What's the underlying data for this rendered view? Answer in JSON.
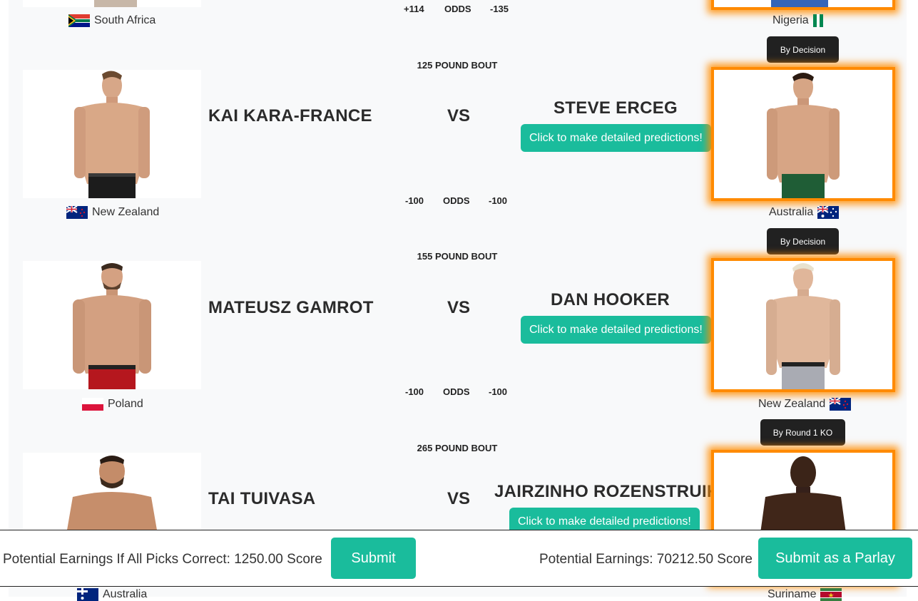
{
  "top_partial": {
    "left_country": "South Africa",
    "odds_left": "+114",
    "odds_label": "ODDS",
    "odds_right": "-135",
    "right_country": "Nigeria",
    "method": "By Decision"
  },
  "bouts": [
    {
      "weight": "125 POUND BOUT",
      "left_name": "KAI KARA-FRANCE",
      "left_country": "New Zealand",
      "vs": "VS",
      "right_name": "STEVE ERCEG",
      "right_country": "Australia",
      "predict_label": "Click to make detailed predictions!",
      "odds_left": "-100",
      "odds_label": "ODDS",
      "odds_right": "-100",
      "method": "By Decision"
    },
    {
      "weight": "155 POUND BOUT",
      "left_name": "MATEUSZ GAMROT",
      "left_country": "Poland",
      "vs": "VS",
      "right_name": "DAN HOOKER",
      "right_country": "New Zealand",
      "predict_label": "Click to make detailed predictions!",
      "odds_left": "-100",
      "odds_label": "ODDS",
      "odds_right": "-100",
      "method": "By Round 1 KO"
    },
    {
      "weight": "265 POUND BOUT",
      "left_name": "TAI TUIVASA",
      "left_country": "Australia",
      "vs": "VS",
      "right_name": "JAIRZINHO ROZENSTRUIK",
      "right_country": "Suriname",
      "predict_label": "Click to make detailed predictions!"
    }
  ],
  "footer": {
    "potential_all": "Potential Earnings If All Picks Correct: 1250.00 Score",
    "submit_label": "Submit",
    "potential_parlay": "Potential Earnings: 70212.50 Score",
    "parlay_label": "Submit as a Parlay"
  },
  "colors": {
    "accent": "#1abc9c",
    "selected_glow": "#ff8a00",
    "method_button": "#212121"
  }
}
